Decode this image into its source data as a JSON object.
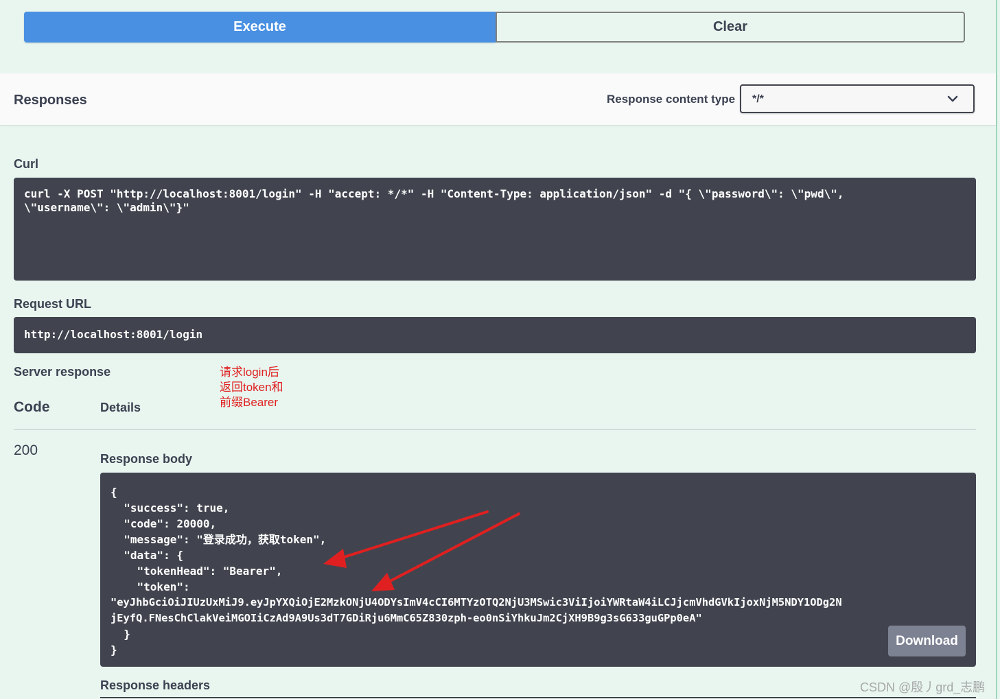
{
  "buttons": {
    "execute": "Execute",
    "clear": "Clear"
  },
  "responses": {
    "title": "Responses",
    "content_type_label": "Response content type",
    "content_type_value": "*/*"
  },
  "curl": {
    "label": "Curl",
    "lines": [
      "curl -X POST \"http://localhost:8001/login\" -H \"accept: */*\" -H \"Content-Type: application/json\" -d \"{ \\\"password\\\": \\\"pwd\\\",",
      "\\\"username\\\": \\\"admin\\\"}\""
    ]
  },
  "request_url": {
    "label": "Request URL",
    "value": "http://localhost:8001/login"
  },
  "server_response": {
    "label": "Server response",
    "annotation": [
      "请求login后",
      "返回token和",
      "前缀Bearer"
    ],
    "col_code": "Code",
    "col_details": "Details",
    "code": "200",
    "body_label": "Response body",
    "body_lines": [
      "{",
      "  \"success\": true,",
      "  \"code\": 20000,",
      "  \"message\": \"登录成功，获取token\",",
      "  \"data\": {",
      "    \"tokenHead\": \"Bearer\",",
      "    \"token\":",
      "\"eyJhbGciOiJIUzUxMiJ9.eyJpYXQiOjE2MzkONjU4ODYsImV4cCI6MTYzOTQ2NjU3MSwic3ViIjoiYWRtaW4iLCJjcmVhdGVkIjoxNjM5NDY1ODg2N",
      "jEyfQ.FNesChClakVeiMGOIiCzAd9A9Us3dT7GDiRju6MmC65Z830zph-eo0nSiYhkuJm2CjXH9B9g3sG633guGPp0eA\"",
      "  }",
      "}"
    ],
    "download": "Download",
    "headers_label": "Response headers"
  },
  "watermark": "CSDN @殷丿grd_志鹏",
  "colors": {
    "execute": "#4990e2",
    "code_bg": "#41444e",
    "annotation": "#e02020",
    "page_bg": "#e8f6ef"
  },
  "icons": {
    "content_type_dropdown": "chevron-down-icon"
  }
}
